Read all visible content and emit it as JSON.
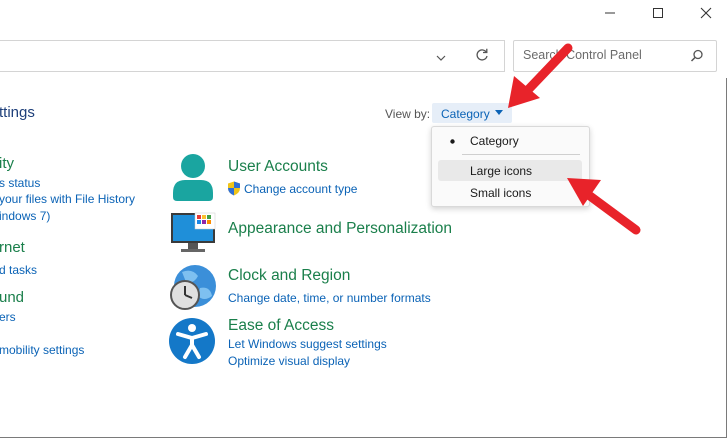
{
  "window": {
    "minimize_icon": "minimize-icon",
    "maximize_icon": "maximize-icon",
    "close_icon": "close-icon"
  },
  "toolbar": {
    "search_placeholder": "Search Control Panel",
    "refresh_icon": "refresh-icon",
    "dropdown_icon": "chevron-down-icon",
    "search_icon": "search-icon"
  },
  "header": {
    "title_partial": "ttings",
    "view_by_label": "View by:",
    "view_by_value": "Category"
  },
  "view_menu": {
    "items": [
      {
        "label": "Category",
        "selected": true
      },
      {
        "label": "Large icons",
        "selected": false
      },
      {
        "label": "Small icons",
        "selected": false
      }
    ]
  },
  "left_column": {
    "items": [
      {
        "title": "ity",
        "links": [
          "s status",
          "your files with File History",
          "indows 7)"
        ]
      },
      {
        "title": "rnet",
        "links": [
          "d tasks"
        ]
      },
      {
        "title": "und",
        "links": [
          "ers"
        ]
      },
      {
        "title": "",
        "links": [
          "mobility settings"
        ]
      }
    ]
  },
  "categories": [
    {
      "title": "User Accounts",
      "icon": "user-accounts-icon",
      "links": [
        "Change account type"
      ],
      "link_icon": "uac-shield-icon"
    },
    {
      "title": "Appearance and Personalization",
      "icon": "appearance-monitor-icon",
      "links": []
    },
    {
      "title": "Clock and Region",
      "icon": "clock-globe-icon",
      "links": [
        "Change date, time, or number formats"
      ]
    },
    {
      "title": "Ease of Access",
      "icon": "ease-of-access-icon",
      "links": [
        "Let Windows suggest settings",
        "Optimize visual display"
      ]
    }
  ],
  "colors": {
    "link": "#0b63b6",
    "category_title": "#1a7f4b",
    "annotation_arrow": "#e8232a"
  }
}
